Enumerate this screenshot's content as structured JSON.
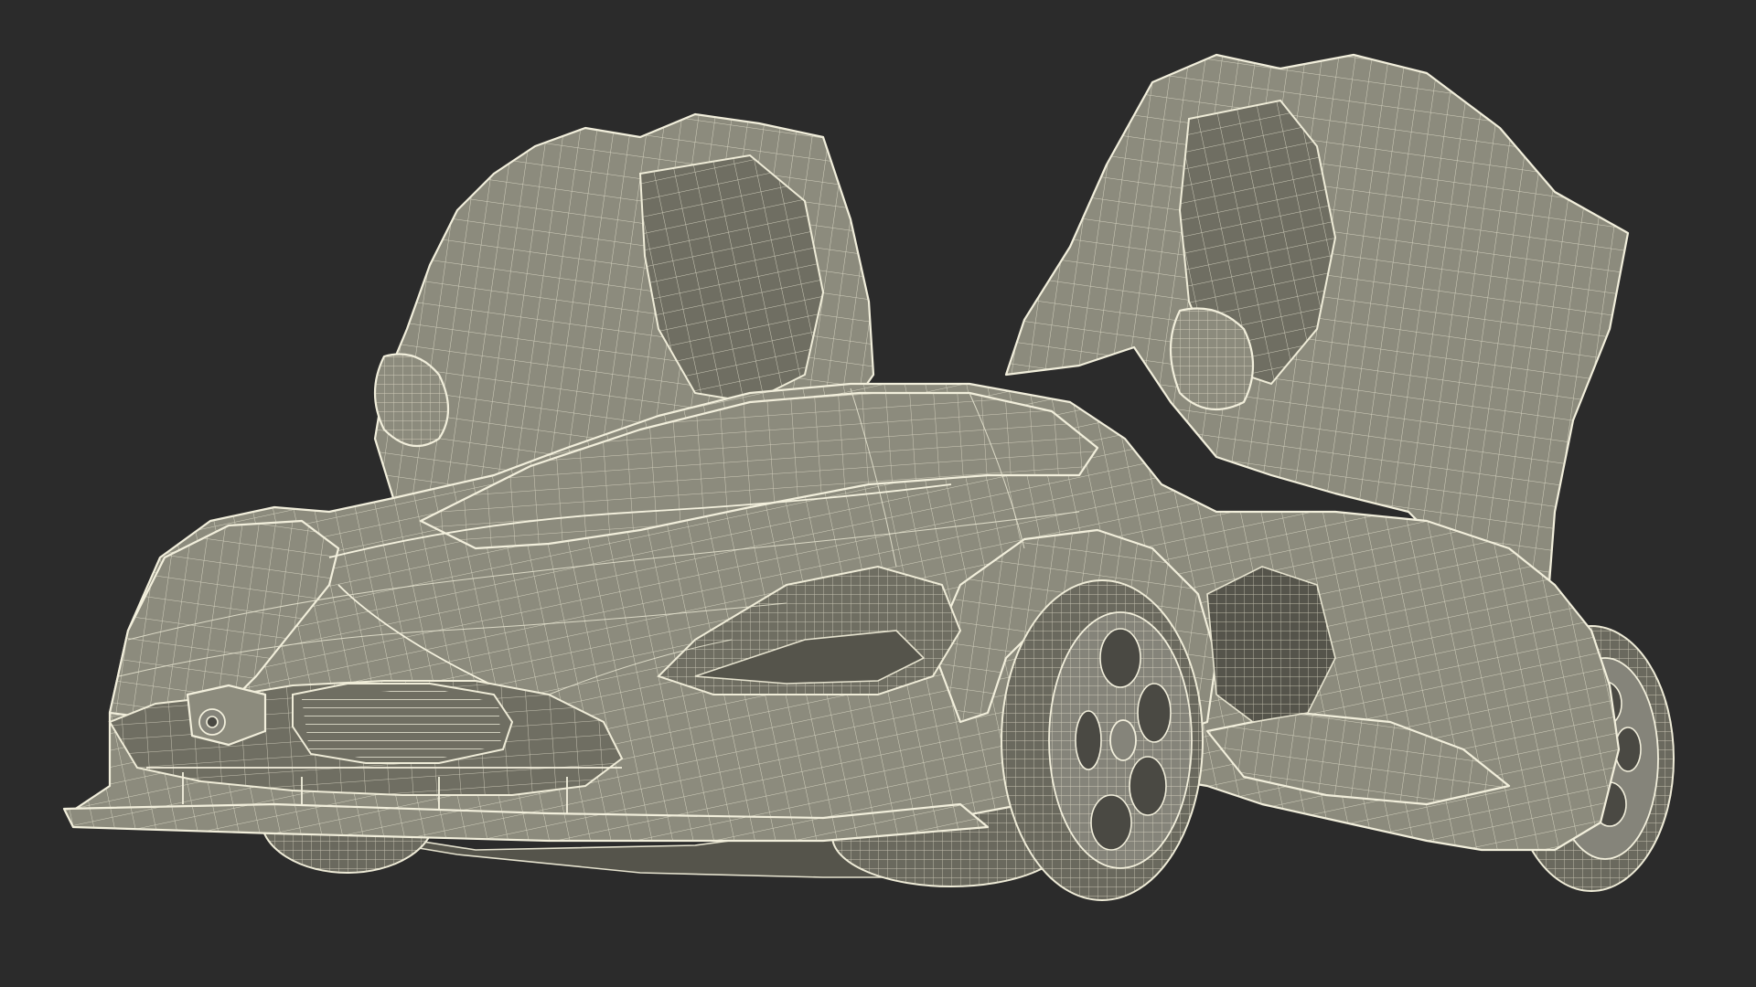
{
  "scene": {
    "background_color": "#2b2b2b",
    "model_fill_color": "#8c8b7d",
    "wire_color": "#f2efdc"
  }
}
